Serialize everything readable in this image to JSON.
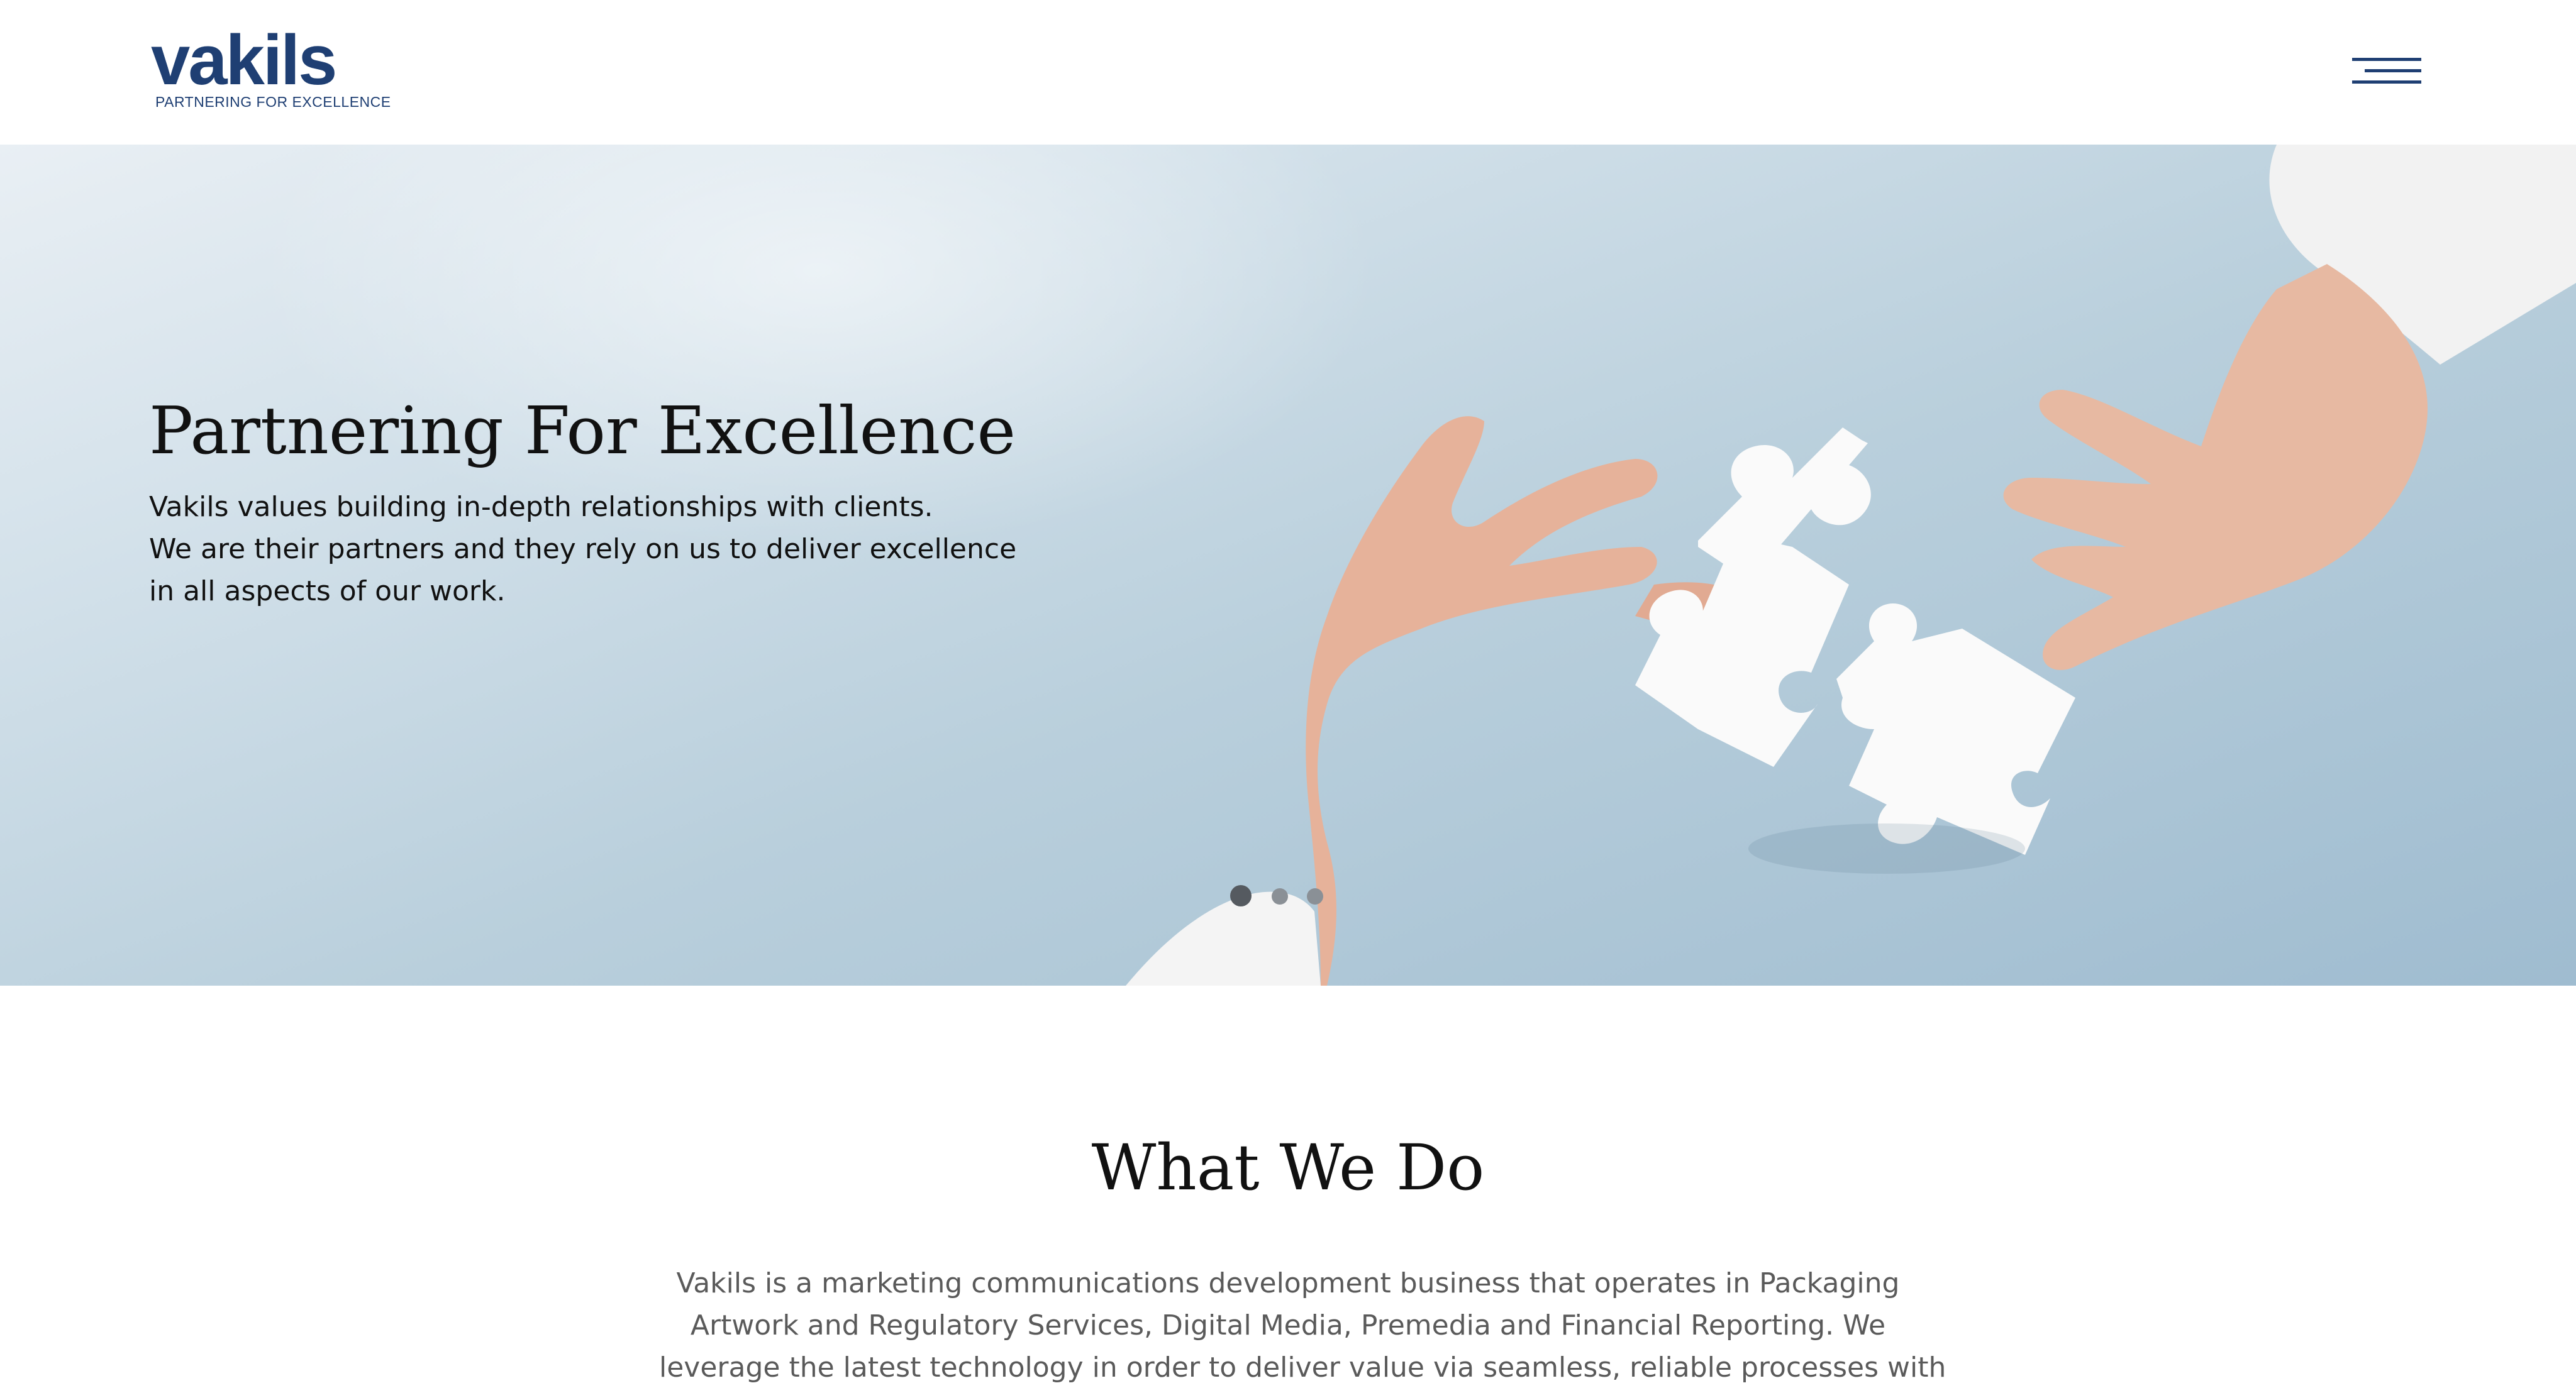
{
  "header": {
    "logo": {
      "wordmark": "vakils",
      "tagline": "PARTNERING FOR EXCELLENCE"
    },
    "menu_icon": "hamburger-menu-icon"
  },
  "hero": {
    "title": "Partnering For Excellence",
    "lines": [
      "Vakils values building in-depth relationships with clients.",
      "We are their partners and they rely on us to deliver excellence",
      "in all aspects of our work."
    ],
    "image": "hands-joining-puzzle-pieces",
    "carousel": {
      "slides": 3,
      "active": 1
    }
  },
  "what_we_do": {
    "title": "What We Do",
    "lines": [
      "Vakils is a marketing communications development business that operates in Packaging",
      "Artwork and Regulatory Services, Digital Media, Premedia and Financial Reporting. We",
      "leverage the latest technology in order to deliver value via seamless, reliable processes with"
    ]
  },
  "colors": {
    "brand": "#1f3f73",
    "text": "#111111",
    "muted_text": "#5a5a5a"
  }
}
